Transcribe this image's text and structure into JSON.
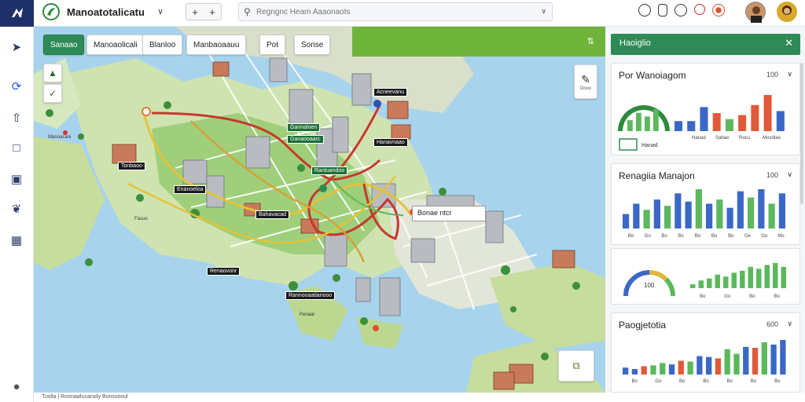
{
  "app": {
    "title": "Manoatotalicatu"
  },
  "search": {
    "placeholder": "Regngnc Heam Aaaonaots"
  },
  "toolbar": {
    "add_a": "+",
    "add_b": "+"
  },
  "chips": [
    "Sanaao",
    "Manoaolicali",
    "Blanloo",
    "Manbaoaauu",
    "Pot",
    "Sonse"
  ],
  "map_labels": [
    "Tonbaoo",
    "Enanoeloa",
    "Bahavacad",
    "Gannaloen",
    "Rantuandoo",
    "Hanavnaao",
    "Renaovonr",
    "Rannooaatianooo",
    "Ganaooaarc",
    "Acneevanu"
  ],
  "map_small_text": [
    "Manoacani",
    "Fasuo",
    "Penaat"
  ],
  "callout": {
    "text": "Bonae ntcr"
  },
  "map_buttons": {
    "pencil_caption": "Dnov"
  },
  "panel": {
    "title": "Haoiglio",
    "cards": [
      {
        "title": "Por Wanoiagom",
        "value": "100",
        "legend": [
          "Hanad",
          "Sabae",
          "Rocu",
          "Mosdtao"
        ],
        "gauge_label": "Hanad",
        "chart_data": {
          "type": "bar",
          "categories": [
            "Nanoe",
            "Booe",
            "Ooe",
            "Saooe",
            "Ooe",
            "Moa",
            "Pel",
            "Haos",
            "Buoe"
          ],
          "values": [
            25,
            25,
            60,
            45,
            30,
            40,
            65,
            90,
            50
          ],
          "series": [
            {
              "values": [
                25,
                25,
                60,
                45,
                30,
                40,
                65,
                90,
                50
              ]
            }
          ]
        }
      },
      {
        "title": "Renagiia Manajon",
        "value": "100",
        "chart_data": {
          "type": "bar",
          "categories": [
            "Bo",
            "Go",
            "Bo",
            "Bs",
            "Bo",
            "Bo",
            "Bo",
            "Ge",
            "Go",
            "Mo"
          ],
          "values": [
            35,
            60,
            45,
            70,
            55,
            85,
            65,
            95,
            60,
            70,
            50,
            90,
            75,
            95,
            60,
            85
          ]
        }
      },
      {
        "title": "",
        "value": "",
        "gauge_value": "100",
        "chart_data": {
          "type": "bar",
          "categories": [
            "Bo",
            "Go",
            "Bo",
            "Bo"
          ],
          "values": [
            10,
            20,
            25,
            35,
            30,
            40,
            45,
            55,
            50,
            60,
            65,
            55
          ]
        }
      },
      {
        "title": "Paogjetotia",
        "value": "600",
        "chart_data": {
          "type": "bar",
          "categories": [
            "Bo",
            "Go",
            "Bo",
            "Bo",
            "Bo",
            "Bo",
            "Bo"
          ],
          "values": [
            15,
            12,
            18,
            20,
            25,
            22,
            30,
            28,
            40,
            38,
            35,
            55,
            45,
            60,
            58,
            70,
            65,
            75
          ]
        }
      }
    ]
  },
  "footer": {
    "text": "Tuslla | Roonaafucanoty Bonsvooul"
  },
  "colors": {
    "accent": "#2e8b57",
    "brand": "#1f2f6a",
    "blue": "#3b68c7",
    "red": "#e05a3a",
    "green": "#5cb85c"
  }
}
